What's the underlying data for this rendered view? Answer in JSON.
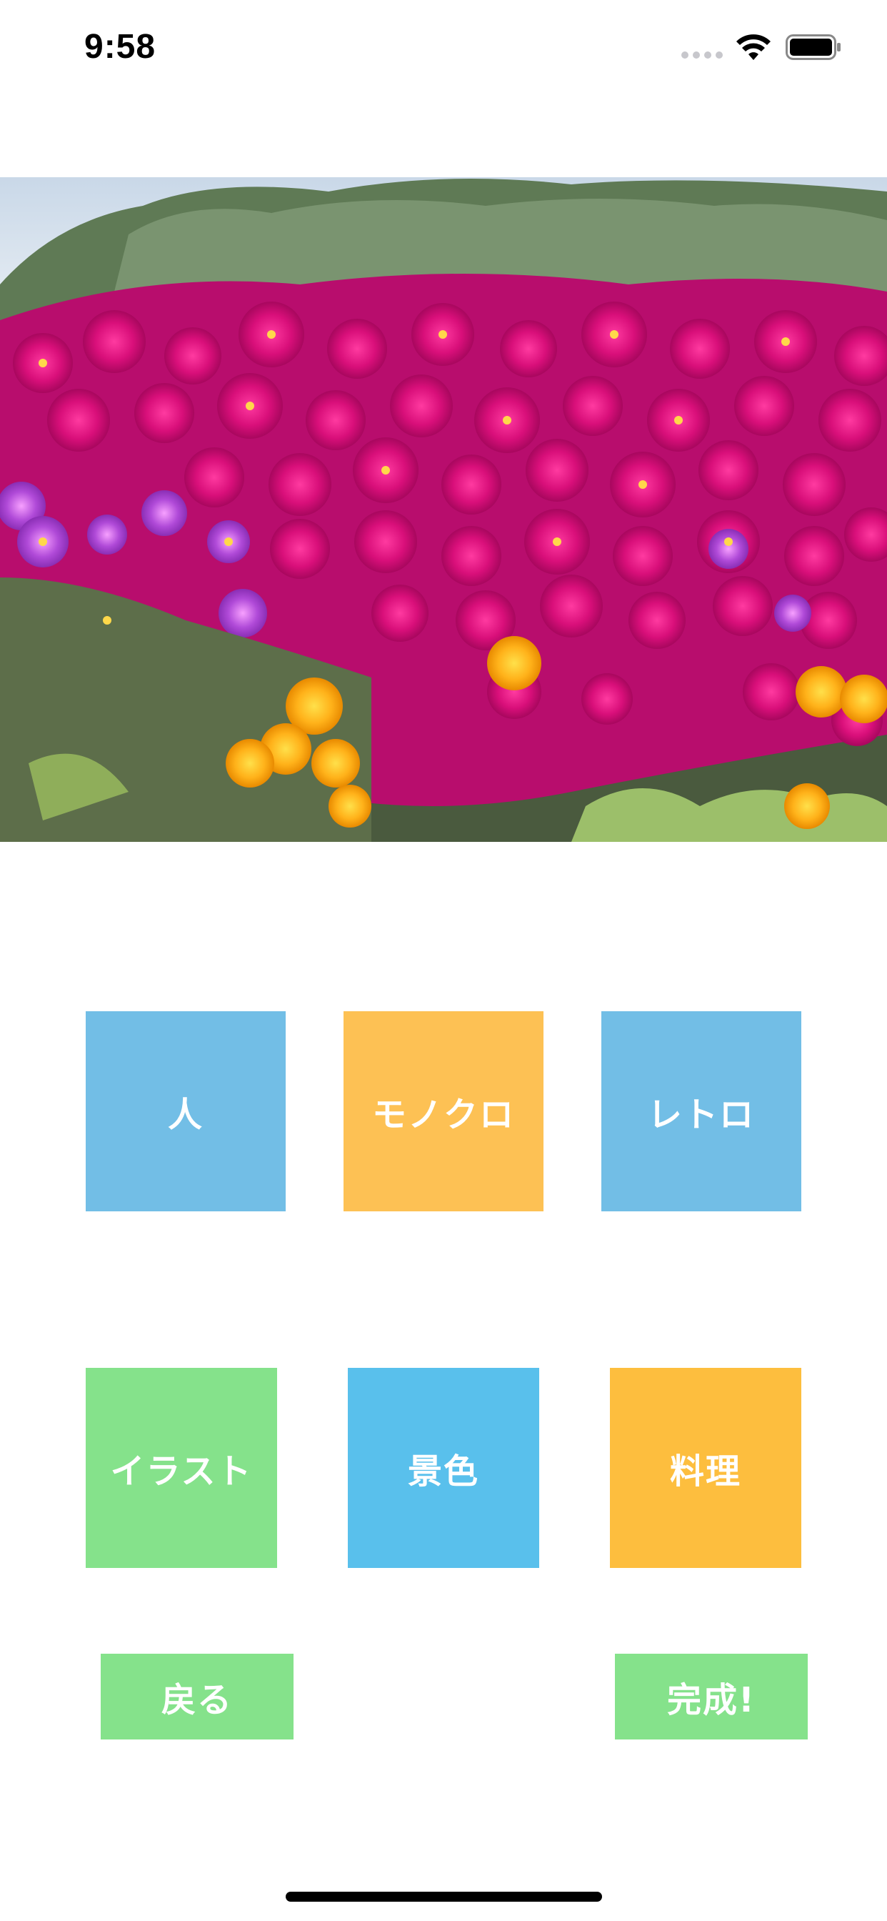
{
  "status_bar": {
    "time": "9:58"
  },
  "photo": {
    "description_icon": "flower-field-photo"
  },
  "filters": [
    {
      "label": "人",
      "color": "#72BEE6"
    },
    {
      "label": "モノクロ",
      "color": "#FDC154"
    },
    {
      "label": "レトロ",
      "color": "#72BEE6"
    },
    {
      "label": "イラスト",
      "color": "#85E28B"
    },
    {
      "label": "景色",
      "color": "#59C0EC"
    },
    {
      "label": "料理",
      "color": "#FDBE3E"
    }
  ],
  "actions": {
    "back_label": "戻る",
    "done_label": "完成!",
    "color": "#85E28B"
  }
}
